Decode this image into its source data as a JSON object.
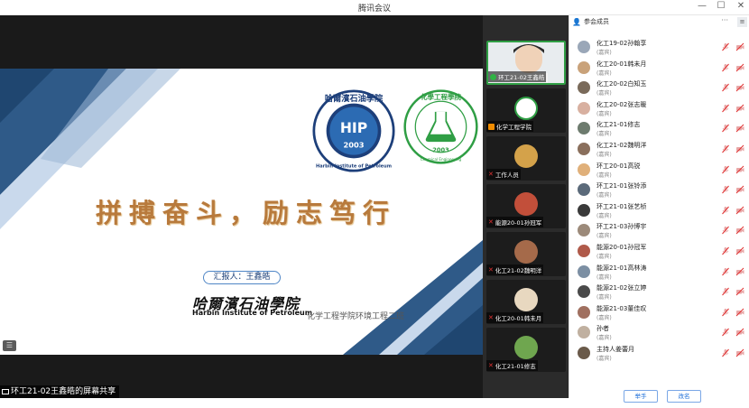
{
  "window": {
    "title": "腾讯会议",
    "minimize": "—",
    "maximize": "☐",
    "close": "✕"
  },
  "slide": {
    "motto": "拼搏奋斗，励志笃行",
    "reporter": "汇报人：王鑫皓",
    "school_cn": "哈爾濱石油學院",
    "school_en": "Harbin Institute of Petroleum",
    "department": "化学工程学院环境工程二班",
    "logo_hip": {
      "letters": "HIP",
      "year": "2003",
      "ring_text": "Harbin Institute of Petroleum",
      "top_text": "哈爾濱石油學院"
    },
    "logo_chem": {
      "year": "2003",
      "ring_text": "化學工程學院",
      "ring_en": "Chemical Engineering"
    }
  },
  "share_label": "环工21-02王鑫皓的屏幕共享",
  "videos": [
    {
      "name": "环工21-02王鑫皓",
      "active": true,
      "icon": "mic-on-icon"
    },
    {
      "name": "化学工程学院",
      "active": false,
      "icon": "host-icon"
    },
    {
      "name": "工作人员",
      "active": false,
      "icon": "mic-off-icon"
    },
    {
      "name": "能源20-01孙冠军",
      "active": false,
      "icon": "mic-off-icon"
    },
    {
      "name": "化工21-02魏明洋",
      "active": false,
      "icon": "mic-off-icon"
    },
    {
      "name": "化工20-01韩未月",
      "active": false,
      "icon": "mic-off-icon"
    },
    {
      "name": "化工21-01修志",
      "active": false,
      "icon": "mic-off-icon"
    }
  ],
  "panel": {
    "title": "参会成员",
    "more": "···",
    "participants": [
      {
        "name": "化工19-02孙翰享",
        "role": "(嘉宾)",
        "avatar_color": "#9aa7b8"
      },
      {
        "name": "化工20-01韩未月",
        "role": "(嘉宾)",
        "avatar_color": "#c9a27a"
      },
      {
        "name": "化工20-02白知玉",
        "role": "(嘉宾)",
        "avatar_color": "#7a6a5a"
      },
      {
        "name": "化工20-02张志暖",
        "role": "(嘉宾)",
        "avatar_color": "#d8b0a0"
      },
      {
        "name": "化工21-01修志",
        "role": "(嘉宾)",
        "avatar_color": "#6d7b6e"
      },
      {
        "name": "化工21-02魏明洋",
        "role": "(嘉宾)",
        "avatar_color": "#8a6f5c"
      },
      {
        "name": "环工20-01高锐",
        "role": "(嘉宾)",
        "avatar_color": "#e0b07a"
      },
      {
        "name": "环工21-01张铃添",
        "role": "(嘉宾)",
        "avatar_color": "#5b6a7a"
      },
      {
        "name": "环工21-01张艺桢",
        "role": "(嘉宾)",
        "avatar_color": "#3a3a3a"
      },
      {
        "name": "环工21-03孙博宇",
        "role": "(嘉宾)",
        "avatar_color": "#9c8a7a"
      },
      {
        "name": "能源20-01孙冠军",
        "role": "(嘉宾)",
        "avatar_color": "#b05a4a"
      },
      {
        "name": "能源21-01高林涛",
        "role": "(嘉宾)",
        "avatar_color": "#7c8fa3"
      },
      {
        "name": "能源21-02张立婷",
        "role": "(嘉宾)",
        "avatar_color": "#4a4a4a"
      },
      {
        "name": "能源21-03董佳叹",
        "role": "(嘉宾)",
        "avatar_color": "#a07060"
      },
      {
        "name": "孙者",
        "role": "(嘉宾)",
        "avatar_color": "#c0b0a0"
      },
      {
        "name": "主持人姜蕾月",
        "role": "(嘉宾)",
        "avatar_color": "#6a5a4a"
      }
    ],
    "buttons": {
      "raise_hand": "举手",
      "rename": "改名"
    }
  },
  "colors": {
    "accent_blue": "#2b6cb0",
    "gold": "#b87a3c",
    "green": "#2f9e44",
    "mute_red": "#e03131"
  }
}
